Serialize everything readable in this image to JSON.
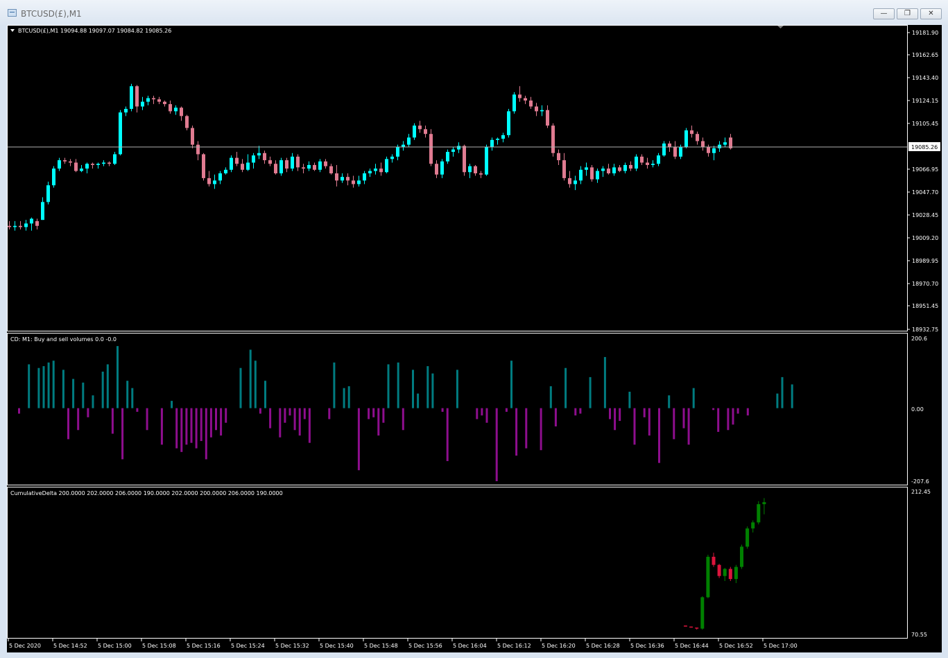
{
  "window": {
    "title": "BTCUSD(£),M1",
    "icon": "chart-window-icon",
    "controls": [
      "minimize-icon",
      "restore-icon",
      "close-icon"
    ]
  },
  "main_panel": {
    "label": "BTCUSD(£),M1  19094.88 19097.07 19084.82 19085.26",
    "price_ticks": [
      "19181.90",
      "19162.65",
      "19143.40",
      "19124.15",
      "19105.45",
      "19085.26",
      "19066.95",
      "19047.70",
      "19028.45",
      "19009.20",
      "18989.95",
      "18970.70",
      "18951.45",
      "18932.75"
    ],
    "current_price": "19085.26"
  },
  "cd_panel": {
    "label": "CD: M1: Buy and sell volumes  0.0 -0.0",
    "scale": [
      "200.6",
      "0.00",
      "-207.6"
    ]
  },
  "cum_panel": {
    "label": "CumulativeDelta 200.0000 202.0000 206.0000 190.0000 202.0000 200.0000 206.0000 190.0000",
    "scale": [
      "212.45",
      "70.55"
    ]
  },
  "time_axis": [
    "5 Dec 2020",
    "5 Dec 14:52",
    "5 Dec 15:00",
    "5 Dec 15:08",
    "5 Dec 15:16",
    "5 Dec 15:24",
    "5 Dec 15:32",
    "5 Dec 15:40",
    "5 Dec 15:48",
    "5 Dec 15:56",
    "5 Dec 16:04",
    "5 Dec 16:12",
    "5 Dec 16:20",
    "5 Dec 16:28",
    "5 Dec 16:36",
    "5 Dec 16:44",
    "5 Dec 16:52",
    "5 Dec 17:00"
  ],
  "colors": {
    "bull": "#00ffff",
    "bear": "#e07b91",
    "buy_vol": "#007c80",
    "sell_vol": "#8e0e8e",
    "cum_up": "#008000",
    "cum_down": "#dc143c"
  },
  "chart_data": [
    {
      "type": "candlestick",
      "name": "BTCUSD(£),M1",
      "ohlc_approx": [
        [
          19020,
          19024,
          19017,
          19019
        ],
        [
          19019,
          19024,
          19016,
          19020
        ],
        [
          19020,
          19024,
          19017,
          19019
        ],
        [
          19019,
          19025,
          19016,
          19022
        ],
        [
          19022,
          19027,
          19016,
          19026
        ],
        [
          19024,
          19026,
          19017,
          19020
        ],
        [
          19025,
          19044,
          19025,
          19040
        ],
        [
          19040,
          19057,
          19038,
          19054
        ],
        [
          19054,
          19070,
          19052,
          19068
        ],
        [
          19068,
          19077,
          19066,
          19075
        ],
        [
          19075,
          19077,
          19072,
          19074
        ],
        [
          19074,
          19076,
          19070,
          19073
        ],
        [
          19073,
          19076,
          19065,
          19066
        ],
        [
          19066,
          19071,
          19065,
          19068
        ],
        [
          19068,
          19073,
          19064,
          19072
        ],
        [
          19072,
          19073,
          19068,
          19071
        ],
        [
          19071,
          19073,
          19068,
          19072
        ],
        [
          19072,
          19075,
          19070,
          19073
        ],
        [
          19073,
          19074,
          19070,
          19072
        ],
        [
          19072,
          19082,
          19071,
          19080
        ],
        [
          19080,
          19117,
          19079,
          19115
        ],
        [
          19115,
          19120,
          19112,
          19118
        ],
        [
          19118,
          19139,
          19116,
          19137
        ],
        [
          19137,
          19138,
          19115,
          19120
        ],
        [
          19120,
          19128,
          19117,
          19124
        ],
        [
          19124,
          19129,
          19121,
          19127
        ],
        [
          19127,
          19129,
          19122,
          19126
        ],
        [
          19126,
          19128,
          19122,
          19124
        ],
        [
          19124,
          19125,
          19120,
          19122
        ],
        [
          19122,
          19125,
          19114,
          19116
        ],
        [
          19116,
          19121,
          19113,
          19119
        ],
        [
          19119,
          19120,
          19108,
          19112
        ],
        [
          19112,
          19113,
          19100,
          19102
        ],
        [
          19102,
          19104,
          19085,
          19088
        ],
        [
          19088,
          19091,
          19075,
          19080
        ],
        [
          19080,
          19081,
          19058,
          19060
        ],
        [
          19060,
          19066,
          19053,
          19055
        ],
        [
          19055,
          19063,
          19051,
          19058
        ],
        [
          19058,
          19066,
          19055,
          19064
        ],
        [
          19064,
          19069,
          19063,
          19067
        ],
        [
          19067,
          19079,
          19065,
          19077
        ],
        [
          19077,
          19082,
          19070,
          19072
        ],
        [
          19072,
          19076,
          19065,
          19067
        ],
        [
          19067,
          19080,
          19066,
          19073
        ],
        [
          19073,
          19081,
          19068,
          19079
        ],
        [
          19079,
          19087,
          19076,
          19081
        ],
        [
          19081,
          19083,
          19072,
          19075
        ],
        [
          19075,
          19078,
          19070,
          19072
        ],
        [
          19072,
          19075,
          19063,
          19064
        ],
        [
          19064,
          19077,
          19062,
          19075
        ],
        [
          19075,
          19077,
          19065,
          19068
        ],
        [
          19068,
          19081,
          19066,
          19078
        ],
        [
          19078,
          19080,
          19066,
          19069
        ],
        [
          19069,
          19072,
          19064,
          19068
        ],
        [
          19068,
          19074,
          19066,
          19071
        ],
        [
          19071,
          19073,
          19066,
          19067
        ],
        [
          19067,
          19076,
          19065,
          19074
        ],
        [
          19074,
          19076,
          19068,
          19070
        ],
        [
          19070,
          19072,
          19063,
          19064
        ],
        [
          19064,
          19071,
          19053,
          19058
        ],
        [
          19058,
          19064,
          19056,
          19061
        ],
        [
          19061,
          19064,
          19054,
          19058
        ],
        [
          19058,
          19062,
          19052,
          19055
        ],
        [
          19055,
          19062,
          19053,
          19058
        ],
        [
          19058,
          19066,
          19055,
          19064
        ],
        [
          19064,
          19068,
          19061,
          19066
        ],
        [
          19066,
          19072,
          19063,
          19068
        ],
        [
          19068,
          19073,
          19062,
          19065
        ],
        [
          19065,
          19078,
          19064,
          19076
        ],
        [
          19076,
          19080,
          19073,
          19078
        ],
        [
          19078,
          19088,
          19075,
          19086
        ],
        [
          19086,
          19091,
          19083,
          19088
        ],
        [
          19088,
          19097,
          19086,
          19094
        ],
        [
          19094,
          19106,
          19092,
          19104
        ],
        [
          19104,
          19108,
          19098,
          19101
        ],
        [
          19101,
          19104,
          19094,
          19097
        ],
        [
          19097,
          19101,
          19070,
          19072
        ],
        [
          19072,
          19075,
          19060,
          19063
        ],
        [
          19063,
          19076,
          19060,
          19074
        ],
        [
          19074,
          19084,
          19072,
          19082
        ],
        [
          19082,
          19086,
          19078,
          19084
        ],
        [
          19084,
          19090,
          19081,
          19087
        ],
        [
          19087,
          19088,
          19062,
          19065
        ],
        [
          19065,
          19072,
          19060,
          19070
        ],
        [
          19070,
          19071,
          19062,
          19064
        ],
        [
          19064,
          19066,
          19060,
          19063
        ],
        [
          19063,
          19088,
          19062,
          19086
        ],
        [
          19086,
          19094,
          19083,
          19092
        ],
        [
          19092,
          19094,
          19088,
          19093
        ],
        [
          19093,
          19098,
          19090,
          19096
        ],
        [
          19096,
          19118,
          19094,
          19116
        ],
        [
          19116,
          19132,
          19114,
          19130
        ],
        [
          19130,
          19137,
          19124,
          19127
        ],
        [
          19127,
          19129,
          19122,
          19125
        ],
        [
          19125,
          19128,
          19118,
          19120
        ],
        [
          19120,
          19123,
          19112,
          19116
        ],
        [
          19116,
          19121,
          19112,
          19117
        ],
        [
          19117,
          19121,
          19102,
          19104
        ],
        [
          19104,
          19106,
          19078,
          19081
        ],
        [
          19081,
          19084,
          19071,
          19075
        ],
        [
          19075,
          19081,
          19058,
          19060
        ],
        [
          19060,
          19066,
          19052,
          19055
        ],
        [
          19055,
          19062,
          19050,
          19058
        ],
        [
          19058,
          19070,
          19055,
          19067
        ],
        [
          19067,
          19073,
          19062,
          19069
        ],
        [
          19069,
          19071,
          19057,
          19059
        ],
        [
          19059,
          19068,
          19056,
          19066
        ],
        [
          19066,
          19070,
          19061,
          19068
        ],
        [
          19068,
          19072,
          19063,
          19064
        ],
        [
          19064,
          19072,
          19062,
          19069
        ],
        [
          19069,
          19071,
          19065,
          19066
        ],
        [
          19066,
          19073,
          19064,
          19071
        ],
        [
          19071,
          19074,
          19066,
          19068
        ],
        [
          19068,
          19080,
          19066,
          19078
        ],
        [
          19078,
          19080,
          19071,
          19073
        ],
        [
          19073,
          19077,
          19068,
          19071
        ],
        [
          19071,
          19075,
          19069,
          19072
        ],
        [
          19072,
          19081,
          19070,
          19079
        ],
        [
          19079,
          19091,
          19078,
          19089
        ],
        [
          19089,
          19091,
          19082,
          19086
        ],
        [
          19086,
          19091,
          19076,
          19078
        ],
        [
          19078,
          19088,
          19076,
          19086
        ],
        [
          19086,
          19102,
          19085,
          19100
        ],
        [
          19100,
          19104,
          19094,
          19097
        ],
        [
          19097,
          19099,
          19088,
          19091
        ],
        [
          19091,
          19094,
          19083,
          19086
        ],
        [
          19086,
          19088,
          19078,
          19081
        ],
        [
          19081,
          19087,
          19075,
          19085
        ],
        [
          19085,
          19091,
          19082,
          19088
        ],
        [
          19088,
          19094,
          19086,
          19090
        ],
        [
          19094,
          19097,
          19084,
          19085
        ]
      ]
    },
    {
      "type": "bar",
      "name": "CD: M1: Buy and sell volumes",
      "ylim": [
        -207.6,
        200.6
      ],
      "values": [
        -15,
        0,
        120,
        0,
        110,
        115,
        125,
        130,
        0,
        105,
        -85,
        80,
        -60,
        70,
        -25,
        35,
        0,
        100,
        120,
        -70,
        170,
        -140,
        75,
        55,
        -10,
        0,
        -60,
        0,
        0,
        -100,
        0,
        20,
        -110,
        -120,
        -100,
        -95,
        -110,
        -90,
        -140,
        -80,
        -60,
        -75,
        -40,
        0,
        0,
        110,
        0,
        160,
        130,
        -15,
        75,
        -55,
        0,
        -80,
        -40,
        -20,
        -60,
        -75,
        -30,
        -95,
        0,
        0,
        0,
        -30,
        125,
        0,
        55,
        60,
        0,
        -170,
        0,
        -30,
        -25,
        -75,
        -40,
        120,
        0,
        125,
        -60,
        0,
        105,
        40,
        0,
        115,
        95,
        0,
        -10,
        -145,
        0,
        105,
        0,
        0,
        0,
        -30,
        -20,
        -40,
        0,
        -200,
        0,
        -10,
        130,
        -130,
        0,
        -110,
        0,
        0,
        -115,
        0,
        60,
        -50,
        0,
        110,
        0,
        -20,
        -15,
        0,
        85,
        0,
        0,
        140,
        -30,
        -60,
        -35,
        0,
        45,
        -100,
        0,
        -25,
        -75,
        0,
        -150,
        0,
        35,
        -85,
        0,
        -55,
        -100,
        55,
        0,
        0,
        0,
        -5,
        -65,
        0,
        -60,
        -45,
        -15,
        0,
        -20,
        0,
        0,
        0,
        0,
        0,
        40,
        85,
        0,
        65
      ]
    },
    {
      "type": "candlestick",
      "name": "CumulativeDelta",
      "ylim": [
        70.55,
        212.45
      ],
      "ohlc": [
        [
          80,
          80,
          79,
          79
        ],
        [
          79,
          79,
          78,
          78
        ],
        [
          78,
          78,
          76,
          77
        ],
        [
          77,
          109,
          76,
          108
        ],
        [
          108,
          150,
          107,
          148
        ],
        [
          148,
          152,
          138,
          140
        ],
        [
          140,
          141,
          127,
          129
        ],
        [
          129,
          137,
          124,
          136
        ],
        [
          136,
          138,
          124,
          126
        ],
        [
          126,
          140,
          122,
          138
        ],
        [
          138,
          160,
          136,
          158
        ],
        [
          158,
          178,
          156,
          176
        ],
        [
          176,
          184,
          172,
          182
        ],
        [
          182,
          203,
          180,
          200
        ],
        [
          200,
          206,
          190,
          202
        ]
      ]
    }
  ]
}
